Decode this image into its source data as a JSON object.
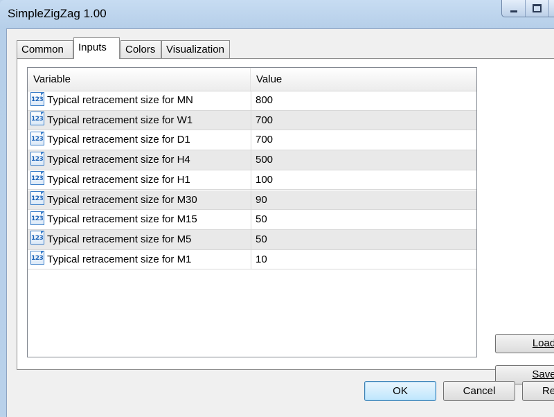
{
  "window": {
    "title": "SimpleZigZag 1.00"
  },
  "tabs": [
    {
      "label": "Common",
      "active": false
    },
    {
      "label": "Inputs",
      "active": true
    },
    {
      "label": "Colors",
      "active": false
    },
    {
      "label": "Visualization",
      "active": false
    }
  ],
  "grid": {
    "headers": {
      "variable": "Variable",
      "value": "Value"
    },
    "icon": "number-123-icon",
    "icon_text": "123",
    "rows": [
      {
        "variable": "Typical retracement size for MN",
        "value": "800"
      },
      {
        "variable": "Typical retracement size for W1",
        "value": "700"
      },
      {
        "variable": "Typical retracement size for D1",
        "value": "700"
      },
      {
        "variable": "Typical retracement size for H4",
        "value": "500"
      },
      {
        "variable": "Typical retracement size for H1",
        "value": "100"
      },
      {
        "variable": "Typical retracement size for M30",
        "value": "90"
      },
      {
        "variable": "Typical retracement size for M15",
        "value": "50"
      },
      {
        "variable": "Typical retracement size for M5",
        "value": "50"
      },
      {
        "variable": "Typical retracement size for M1",
        "value": "10"
      }
    ]
  },
  "side_buttons": {
    "load": "Load",
    "save": "Save"
  },
  "dialog_buttons": {
    "ok": "OK",
    "cancel": "Cancel",
    "reset": "Re"
  }
}
